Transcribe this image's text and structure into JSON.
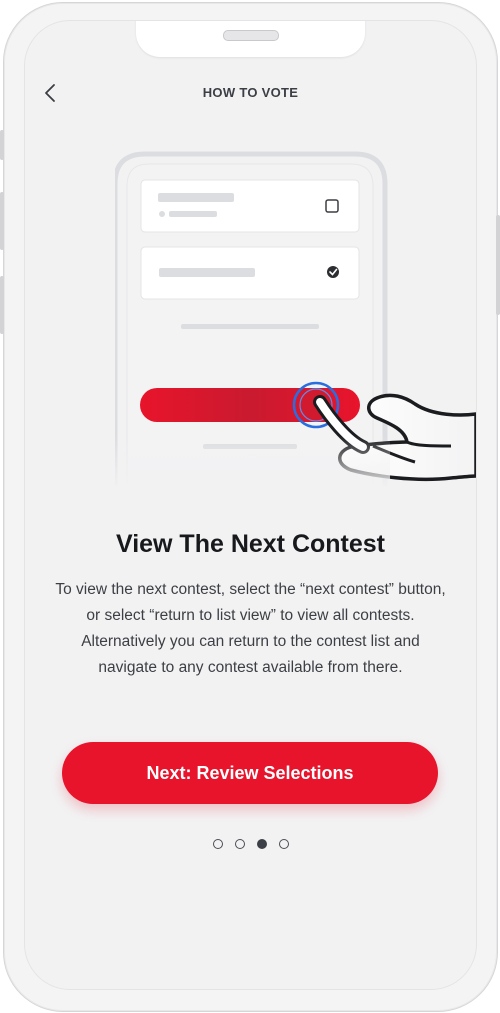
{
  "header": {
    "title": "HOW TO VOTE",
    "back_icon": "chevron-left-icon"
  },
  "step": {
    "headline": "View The Next Contest",
    "description": "To view the next contest, select the “next contest” button, or select “return to list view” to view all contests. Alternatively you can return to the contest list and navigate to any contest available from there."
  },
  "cta": {
    "label": "Next: Review Selections"
  },
  "pagination": {
    "total": 4,
    "current": 3
  },
  "colors": {
    "accent": "#e8142b",
    "text": "#17191c",
    "background": "#f2f2f3"
  }
}
